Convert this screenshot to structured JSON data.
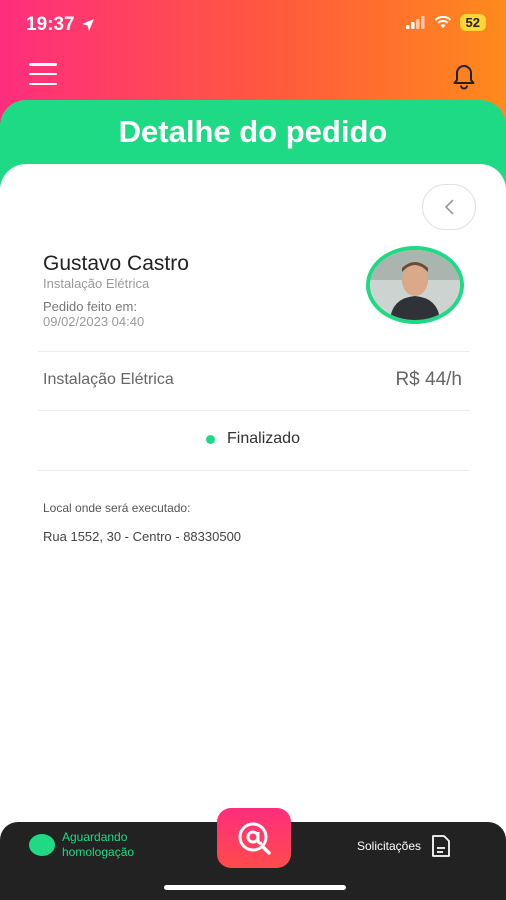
{
  "status_bar": {
    "time": "19:37",
    "battery": "52"
  },
  "header": {
    "title": "Detalhe do pedido"
  },
  "order": {
    "provider_name": "Gustavo Castro",
    "service_subtitle": "Instalação Elétrica",
    "order_label": "Pedido feito em:",
    "order_date": "09/02/2023 04:40",
    "service_name": "Instalação Elétrica",
    "price": "R$ 44/h",
    "status": "Finalizado",
    "location_label": "Local onde será executado:",
    "location_value": "Rua 1552, 30 - Centro - 88330500"
  },
  "bottom_nav": {
    "left_label": "Aguardando homologação",
    "right_label": "Solicitações"
  },
  "colors": {
    "accent_green": "#1fda84",
    "gradient_start": "#ff2d7e",
    "gradient_end": "#ff8a1c",
    "nav_bg": "#222222"
  },
  "icons": [
    "location-arrow-icon",
    "signal-icon",
    "wifi-icon",
    "menu-icon",
    "bell-icon",
    "chevron-left-icon",
    "at-search-icon",
    "document-icon"
  ]
}
